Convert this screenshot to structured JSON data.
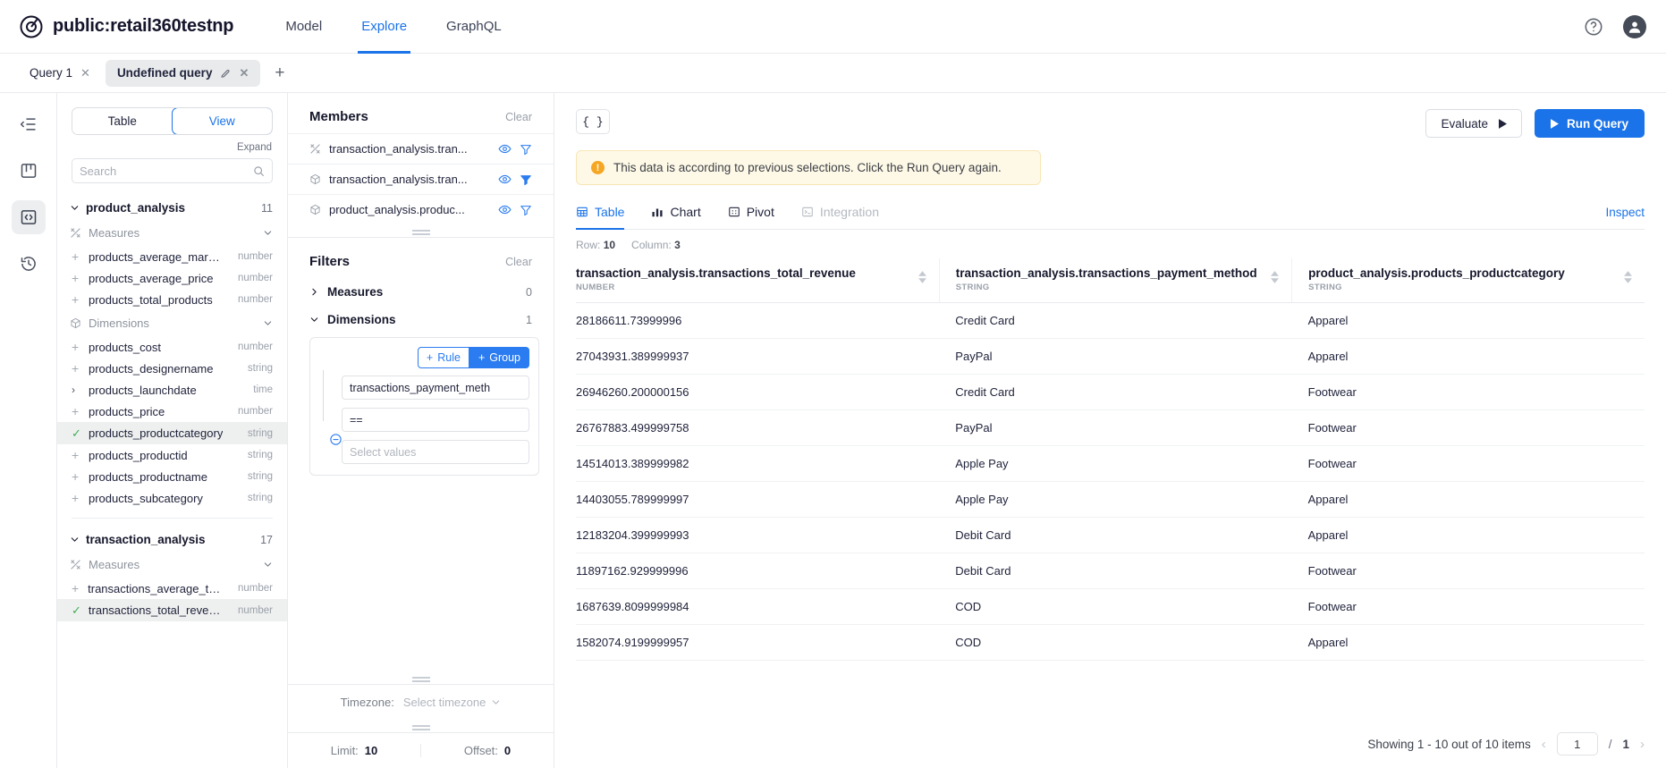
{
  "topbar": {
    "logo_icon": "cube-logo-icon",
    "project": "public:retail360testnp",
    "nav": [
      {
        "label": "Model",
        "active": false
      },
      {
        "label": "Explore",
        "active": true
      },
      {
        "label": "GraphQL",
        "active": false
      }
    ],
    "help_icon": "help-circle-icon",
    "avatar_icon": "user-avatar-icon"
  },
  "query_tabs": {
    "tabs": [
      {
        "label": "Query 1",
        "active": false,
        "has_edit": false
      },
      {
        "label": "Undefined query",
        "active": true,
        "has_edit": true
      }
    ],
    "add_label": "+"
  },
  "rail": {
    "items": [
      {
        "name": "collapse-sidebar-icon",
        "active": false
      },
      {
        "name": "board-icon",
        "active": false
      },
      {
        "name": "code-icon",
        "active": true
      },
      {
        "name": "history-icon",
        "active": false
      }
    ]
  },
  "schema": {
    "segmented": [
      {
        "label": "Table",
        "active": false
      },
      {
        "label": "View",
        "active": true
      }
    ],
    "expand_label": "Expand",
    "search_placeholder": "Search",
    "search_value": "",
    "cubes": [
      {
        "name": "product_analysis",
        "count": "11",
        "groups": [
          {
            "label": "Measures",
            "icon": "measures-icon",
            "members": [
              {
                "name": "products_average_margin",
                "type": "number",
                "state": "plus"
              },
              {
                "name": "products_average_price",
                "type": "number",
                "state": "plus"
              },
              {
                "name": "products_total_products",
                "type": "number",
                "state": "plus"
              }
            ]
          },
          {
            "label": "Dimensions",
            "icon": "dimensions-icon",
            "members": [
              {
                "name": "products_cost",
                "type": "number",
                "state": "plus"
              },
              {
                "name": "products_designername",
                "type": "string",
                "state": "plus"
              },
              {
                "name": "products_launchdate",
                "type": "time",
                "state": "arrow"
              },
              {
                "name": "products_price",
                "type": "number",
                "state": "plus"
              },
              {
                "name": "products_productcategory",
                "type": "string",
                "state": "checked"
              },
              {
                "name": "products_productid",
                "type": "string",
                "state": "plus"
              },
              {
                "name": "products_productname",
                "type": "string",
                "state": "plus"
              },
              {
                "name": "products_subcategory",
                "type": "string",
                "state": "plus"
              }
            ]
          }
        ]
      },
      {
        "name": "transaction_analysis",
        "count": "17",
        "groups": [
          {
            "label": "Measures",
            "icon": "measures-icon",
            "members": [
              {
                "name": "transactions_average_tran...",
                "type": "number",
                "state": "plus"
              },
              {
                "name": "transactions_total_revenue",
                "type": "number",
                "state": "checked"
              }
            ]
          }
        ]
      }
    ]
  },
  "members_panel": {
    "title": "Members",
    "clear_label": "Clear",
    "rows": [
      {
        "icon": "measures-icon",
        "name": "transaction_analysis.tran...",
        "filter_active": false
      },
      {
        "icon": "dimensions-icon",
        "name": "transaction_analysis.tran...",
        "filter_active": true
      },
      {
        "icon": "dimensions-icon",
        "name": "product_analysis.produc...",
        "filter_active": false
      }
    ]
  },
  "filters_panel": {
    "title": "Filters",
    "clear_label": "Clear",
    "measures": {
      "label": "Measures",
      "count": "0",
      "expanded": false
    },
    "dimensions": {
      "label": "Dimensions",
      "count": "1",
      "expanded": true
    },
    "rule_button": "Rule",
    "group_button": "Group",
    "rule": {
      "field": "transactions_payment_meth",
      "operator": "==",
      "values_placeholder": "Select values"
    },
    "timezone": {
      "label": "Timezone:",
      "value": "Select timezone"
    },
    "limit": {
      "label": "Limit:",
      "value": "10"
    },
    "offset": {
      "label": "Offset:",
      "value": "0"
    }
  },
  "main": {
    "json_button": "{ }",
    "evaluate_button": "Evaluate",
    "run_button": "Run Query",
    "banner": {
      "icon": "warning-icon",
      "text": "This data is according to previous selections. Click the Run Query again."
    },
    "view_tabs": [
      {
        "label": "Table",
        "icon": "table-icon",
        "active": true,
        "disabled": false
      },
      {
        "label": "Chart",
        "icon": "chart-icon",
        "active": false,
        "disabled": false
      },
      {
        "label": "Pivot",
        "icon": "pivot-icon",
        "active": false,
        "disabled": false
      },
      {
        "label": "Integration",
        "icon": "terminal-icon",
        "active": false,
        "disabled": true
      }
    ],
    "inspect_label": "Inspect",
    "meta": {
      "row_label": "Row:",
      "row_value": "10",
      "col_label": "Column:",
      "col_value": "3"
    },
    "table": {
      "columns": [
        {
          "name": "transaction_analysis.transactions_total_revenue",
          "type": "NUMBER"
        },
        {
          "name": "transaction_analysis.transactions_payment_method",
          "type": "STRING"
        },
        {
          "name": "product_analysis.products_productcategory",
          "type": "STRING"
        }
      ],
      "rows": [
        [
          "28186611.73999996",
          "Credit Card",
          "Apparel"
        ],
        [
          "27043931.389999937",
          "PayPal",
          "Apparel"
        ],
        [
          "26946260.200000156",
          "Credit Card",
          "Footwear"
        ],
        [
          "26767883.499999758",
          "PayPal",
          "Footwear"
        ],
        [
          "14514013.389999982",
          "Apple Pay",
          "Footwear"
        ],
        [
          "14403055.789999997",
          "Apple Pay",
          "Apparel"
        ],
        [
          "12183204.399999993",
          "Debit Card",
          "Apparel"
        ],
        [
          "11897162.929999996",
          "Debit Card",
          "Footwear"
        ],
        [
          "1687639.8099999984",
          "COD",
          "Footwear"
        ],
        [
          "1582074.9199999957",
          "COD",
          "Apparel"
        ]
      ]
    },
    "pager": {
      "showing": "Showing 1 - 10 out of 10 items",
      "prev_icon": "chevron-left-icon",
      "next_icon": "chevron-right-icon",
      "page": "1",
      "separator": "/",
      "total_pages": "1"
    }
  },
  "colors": {
    "accent": "#1a73e8",
    "link": "#2b7cf0",
    "warning": "#f5a623",
    "banner_bg": "#fef9e7",
    "check_green": "#3fae5a"
  }
}
